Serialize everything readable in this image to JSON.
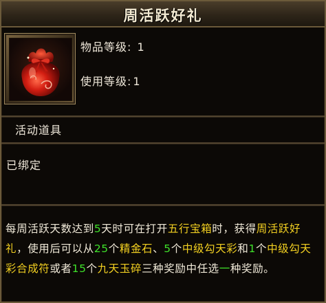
{
  "item": {
    "title": "周活跃好礼",
    "icon": "red-gift-bag-icon",
    "grade_label": "物品等级:",
    "grade_value": "1",
    "use_level_label": "使用等级:",
    "use_level_value": "1",
    "category": "活动道具",
    "bind_status": "已绑定"
  },
  "description": {
    "segments": [
      {
        "text": "每周活跃天数达到",
        "color": "default"
      },
      {
        "text": "5",
        "color": "green"
      },
      {
        "text": "天时可在打开",
        "color": "default"
      },
      {
        "text": "五行宝箱",
        "color": "yellow"
      },
      {
        "text": "时，获得",
        "color": "default"
      },
      {
        "text": "周活跃好礼",
        "color": "yellow"
      },
      {
        "text": "，使用后可以从",
        "color": "default"
      },
      {
        "text": "25",
        "color": "green"
      },
      {
        "text": "个",
        "color": "default"
      },
      {
        "text": "精金石",
        "color": "yellow"
      },
      {
        "text": "、",
        "color": "default"
      },
      {
        "text": "5",
        "color": "green"
      },
      {
        "text": "个",
        "color": "default"
      },
      {
        "text": "中级勾天彩",
        "color": "yellow"
      },
      {
        "text": "和",
        "color": "default"
      },
      {
        "text": "1",
        "color": "green"
      },
      {
        "text": "个",
        "color": "default"
      },
      {
        "text": "中级勾天彩合成符",
        "color": "yellow"
      },
      {
        "text": "或者",
        "color": "default"
      },
      {
        "text": "15",
        "color": "green"
      },
      {
        "text": "个",
        "color": "default"
      },
      {
        "text": "九天玉碎",
        "color": "yellow"
      },
      {
        "text": "三种奖励中任选",
        "color": "default"
      },
      {
        "text": "一",
        "color": "green"
      },
      {
        "text": "种奖励。",
        "color": "default"
      }
    ]
  },
  "colors": {
    "green": "#3fe22a",
    "yellow": "#f3d021",
    "text": "#efe8da",
    "border": "#6b5a3a"
  }
}
